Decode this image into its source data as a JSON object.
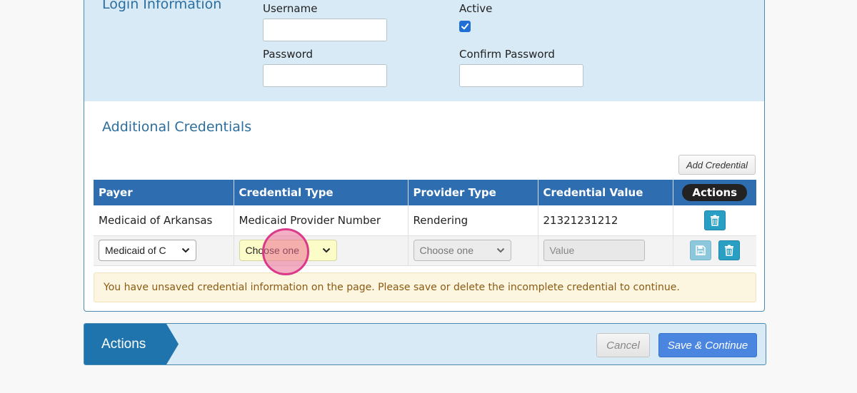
{
  "login": {
    "title": "Login Information",
    "username_label": "Username",
    "username_value": "",
    "active_label": "Active",
    "active_checked": true,
    "password_label": "Password",
    "password_value": "",
    "confirm_label": "Confirm Password",
    "confirm_value": ""
  },
  "credentials": {
    "title": "Additional Credentials",
    "add_button": "Add Credential",
    "columns": [
      "Payer",
      "Credential Type",
      "Provider Type",
      "Credential Value",
      "Actions"
    ],
    "rows": [
      {
        "payer": "Medicaid of Arkansas",
        "credential_type": "Medicaid Provider Number",
        "provider_type": "Rendering",
        "credential_value": "21321231212"
      }
    ],
    "edit_row": {
      "payer_select": "Medicaid of C",
      "credential_type_select": "Choose one",
      "provider_type_select": "Choose one",
      "value_placeholder": "Value"
    },
    "warning": "You have unsaved credential information on the page. Please save or delete the incomplete credential to continue."
  },
  "actions": {
    "title": "Actions",
    "cancel_label": "Cancel",
    "save_label": "Save & Continue"
  },
  "colors": {
    "header_blue": "#2e6eb0",
    "section_bg": "#d8eaf5",
    "title_blue": "#2c6e9e",
    "icon_button": "#2a9fc4",
    "save_button": "#4a86e0"
  }
}
